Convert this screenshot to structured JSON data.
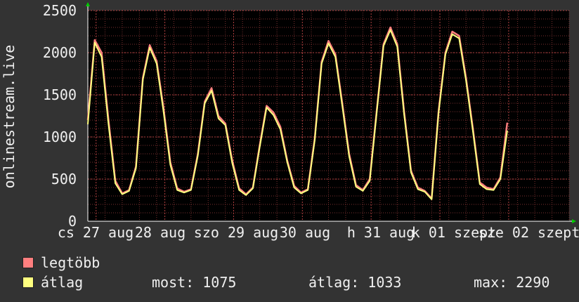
{
  "chart_data": {
    "type": "line",
    "ylabel": "onlinestream.live",
    "ylim": [
      0,
      2500
    ],
    "yticks": [
      "0",
      "500",
      "1000",
      "1500",
      "2000",
      "2500"
    ],
    "xticks": [
      "cs 27 aug",
      "28 aug",
      "szo 29 aug",
      "30 aug",
      "h 31 aug",
      "k 01 szept",
      "sze 02 szept"
    ],
    "x_range_days": [
      0,
      7
    ],
    "x_tick_days": [
      0.12,
      1.12,
      2.12,
      3.12,
      4.12,
      5.12,
      6.12
    ],
    "grid": true,
    "colors": {
      "background": "#333333",
      "plot": "#000000",
      "grid": "#7a3030",
      "max_series": "#ff7f7f",
      "avg_series": "#ffff7f"
    },
    "series": [
      {
        "name": "legtöbb",
        "x_days": [
          0.0,
          0.1,
          0.2,
          0.3,
          0.4,
          0.5,
          0.6,
          0.7,
          0.8,
          0.9,
          1.0,
          1.1,
          1.2,
          1.3,
          1.4,
          1.5,
          1.6,
          1.7,
          1.8,
          1.9,
          2.0,
          2.1,
          2.2,
          2.3,
          2.4,
          2.5,
          2.6,
          2.7,
          2.8,
          2.9,
          3.0,
          3.1,
          3.2,
          3.3,
          3.4,
          3.5,
          3.6,
          3.7,
          3.8,
          3.9,
          4.0,
          4.1,
          4.2,
          4.3,
          4.4,
          4.5,
          4.6,
          4.7,
          4.8,
          4.9,
          5.0,
          5.1,
          5.2,
          5.3,
          5.4,
          5.5,
          5.6,
          5.7,
          5.8,
          5.9,
          6.0,
          6.1,
          6.2,
          6.3,
          6.4,
          6.5,
          6.6,
          6.7,
          6.8,
          6.9,
          7.0
        ],
        "values": [
          1200,
          2150,
          2000,
          1200,
          480,
          330,
          370,
          650,
          1700,
          2090,
          1900,
          1350,
          700,
          390,
          350,
          380,
          800,
          1420,
          1580,
          1250,
          1160,
          720,
          390,
          320,
          400,
          900,
          1370,
          1290,
          1120,
          720,
          420,
          340,
          380,
          980,
          1890,
          2140,
          1980,
          1400,
          800,
          430,
          370,
          500,
          1300,
          2100,
          2300,
          2100,
          1300,
          600,
          400,
          360,
          270,
          1300,
          2000,
          2250,
          2200,
          1700,
          1100,
          460,
          400,
          380,
          520,
          1170
        ]
      },
      {
        "name": "átlag",
        "x_days": [
          0.0,
          0.1,
          0.2,
          0.3,
          0.4,
          0.5,
          0.6,
          0.7,
          0.8,
          0.9,
          1.0,
          1.1,
          1.2,
          1.3,
          1.4,
          1.5,
          1.6,
          1.7,
          1.8,
          1.9,
          2.0,
          2.1,
          2.2,
          2.3,
          2.4,
          2.5,
          2.6,
          2.7,
          2.8,
          2.9,
          3.0,
          3.1,
          3.2,
          3.3,
          3.4,
          3.5,
          3.6,
          3.7,
          3.8,
          3.9,
          4.0,
          4.1,
          4.2,
          4.3,
          4.4,
          4.5,
          4.6,
          4.7,
          4.8,
          4.9,
          5.0,
          5.1,
          5.2,
          5.3,
          5.4,
          5.5,
          5.6,
          5.7,
          5.8,
          5.9,
          6.0,
          6.1,
          6.2,
          6.3,
          6.4,
          6.5,
          6.6,
          6.7,
          6.8,
          6.9,
          7.0
        ],
        "values": [
          1150,
          2120,
          1950,
          1150,
          450,
          320,
          360,
          630,
          1680,
          2060,
          1870,
          1310,
          670,
          370,
          340,
          370,
          780,
          1400,
          1550,
          1220,
          1140,
          690,
          370,
          310,
          390,
          880,
          1350,
          1260,
          1090,
          700,
          400,
          330,
          370,
          960,
          1870,
          2110,
          1950,
          1370,
          770,
          410,
          360,
          480,
          1280,
          2080,
          2270,
          2070,
          1270,
          580,
          380,
          350,
          260,
          1280,
          1980,
          2220,
          2170,
          1670,
          1070,
          440,
          380,
          370,
          500,
          1075
        ]
      }
    ]
  },
  "legend": [
    {
      "label": "legtöbb",
      "color": "#ff7f7f"
    },
    {
      "label": "átlag",
      "color": "#ffff7f"
    }
  ],
  "stats": {
    "now": "most: 1075",
    "avg": "átlag: 1033",
    "max": "max: 2290"
  }
}
